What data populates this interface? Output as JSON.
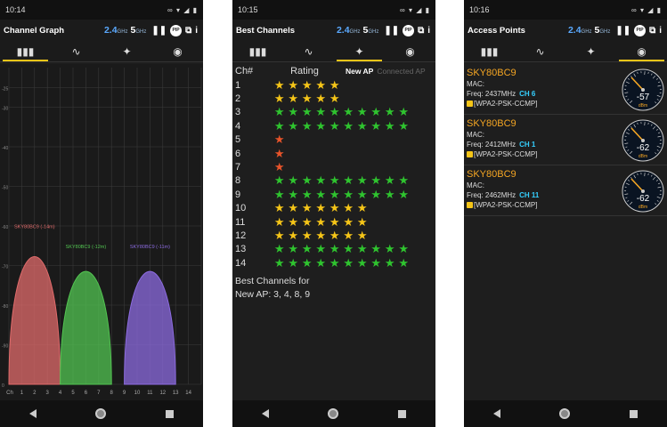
{
  "phone1": {
    "status": {
      "time": "10:14",
      "icons": "∞ ▾ ◢ ▮"
    },
    "title": "Channel Graph",
    "band_24": "2.4",
    "band_24_unit": "GHz",
    "band_5": "5",
    "band_5_unit": "GHz",
    "y_ticks": [
      "-25",
      "-30",
      "-40",
      "-50",
      "-60",
      "-70",
      "-80",
      "-90",
      "0"
    ],
    "x_ticks": [
      "Ch",
      "1",
      "2",
      "3",
      "4",
      "5",
      "6",
      "7",
      "8",
      "9",
      "10",
      "11",
      "12",
      "13",
      "14"
    ],
    "curves": [
      {
        "label": "SKY80BC9 (-14m)",
        "channel": 2,
        "level": -57,
        "color": "#e06b6b"
      },
      {
        "label": "SKY80BC9 (-12m)",
        "channel": 6,
        "level": -62,
        "color": "#52c451"
      },
      {
        "label": "SKY80BC9 (-11m)",
        "channel": 11,
        "level": -62,
        "color": "#8c6be0"
      }
    ]
  },
  "phone2": {
    "status": {
      "time": "10:15",
      "icons": "∞ ▾ ◢ ▮"
    },
    "title": "Best Channels",
    "band_24": "2.4",
    "band_24_unit": "GHz",
    "band_5": "5",
    "band_5_unit": "GHz",
    "header": {
      "ch": "Ch#",
      "rating": "Rating",
      "new_ap": "New AP",
      "connected_ap": "Connected AP"
    },
    "rows": [
      {
        "ch": "1",
        "stars": 5,
        "color": "#f5c518"
      },
      {
        "ch": "2",
        "stars": 5,
        "color": "#f5c518"
      },
      {
        "ch": "3",
        "stars": 10,
        "color": "#2fc42f"
      },
      {
        "ch": "4",
        "stars": 10,
        "color": "#2fc42f"
      },
      {
        "ch": "5",
        "stars": 1,
        "color": "#e8542a"
      },
      {
        "ch": "6",
        "stars": 1,
        "color": "#e8542a"
      },
      {
        "ch": "7",
        "stars": 1,
        "color": "#e8542a"
      },
      {
        "ch": "8",
        "stars": 10,
        "color": "#2fc42f"
      },
      {
        "ch": "9",
        "stars": 10,
        "color": "#2fc42f"
      },
      {
        "ch": "10",
        "stars": 7,
        "color": "#f5c518"
      },
      {
        "ch": "11",
        "stars": 7,
        "color": "#f5c518"
      },
      {
        "ch": "12",
        "stars": 7,
        "color": "#f5c518"
      },
      {
        "ch": "13",
        "stars": 10,
        "color": "#2fc42f"
      },
      {
        "ch": "14",
        "stars": 10,
        "color": "#2fc42f"
      }
    ],
    "best_line1": "Best Channels for",
    "best_line2": "New AP: 3, 4, 8, 9"
  },
  "phone3": {
    "status": {
      "time": "10:16",
      "icons": "∞ ▾ ◢ ▮"
    },
    "title": "Access Points",
    "band_24": "2.4",
    "band_24_unit": "GHz",
    "band_5": "5",
    "band_5_unit": "GHz",
    "aps": [
      {
        "ssid": "SKY80BC9",
        "mac": "MAC:",
        "freq": "Freq: 2437MHz",
        "ch": "CH 6",
        "sec": "[WPA2-PSK-CCMP]",
        "dbm": "-57",
        "unit": "dBm"
      },
      {
        "ssid": "SKY80BC9",
        "mac": "MAC:",
        "freq": "Freq: 2412MHz",
        "ch": "CH 1",
        "sec": "[WPA2-PSK-CCMP]",
        "dbm": "-62",
        "unit": "dBm"
      },
      {
        "ssid": "SKY80BC9",
        "mac": "MAC:",
        "freq": "Freq: 2462MHz",
        "ch": "CH 11",
        "sec": "[WPA2-PSK-CCMP]",
        "dbm": "-62",
        "unit": "dBm"
      }
    ]
  },
  "icons": {
    "pause": "pause-icon",
    "pip": "pip-icon",
    "external": "external-link-icon",
    "info": "info-icon",
    "graph_tab": "bar-chart-icon",
    "time_tab": "time-graph-icon",
    "rating_tab": "stars-icon",
    "ap_tab": "signal-icon"
  },
  "colors": {
    "accent": "#f5c518",
    "band": "#5aa9ff",
    "ssid": "#f5a623",
    "channel": "#35d0ff"
  }
}
